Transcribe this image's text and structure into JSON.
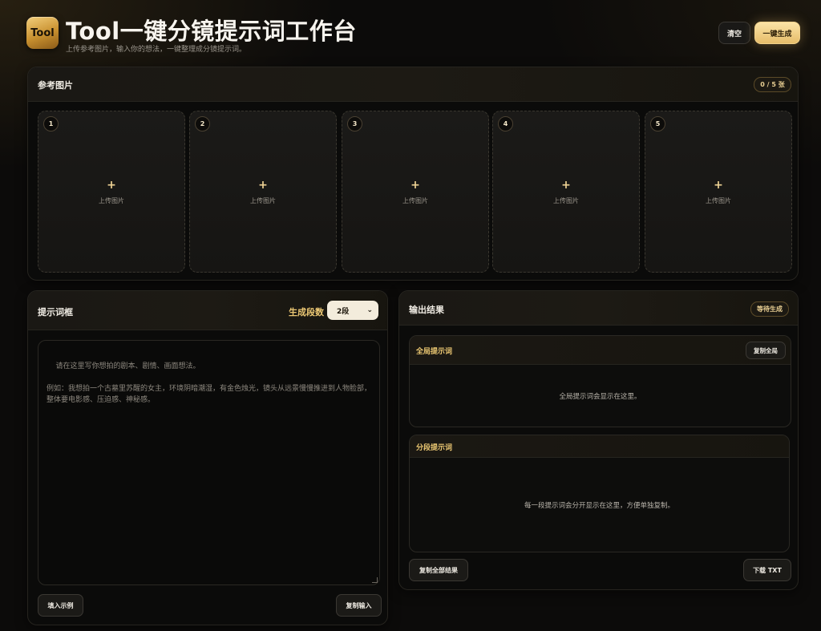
{
  "header": {
    "logo_text": "Tool",
    "title": "Tool一键分镜提示词工作台",
    "subtitle": "上传参考图片，输入你的想法，一键整理成分镜提示词。",
    "clear_label": "清空",
    "generate_label": "一键生成"
  },
  "references": {
    "title": "参考图片",
    "count_badge": "0 / 5 张",
    "slots": [
      {
        "num": "1",
        "plus": "+",
        "label": "上传图片"
      },
      {
        "num": "2",
        "plus": "+",
        "label": "上传图片"
      },
      {
        "num": "3",
        "plus": "+",
        "label": "上传图片"
      },
      {
        "num": "4",
        "plus": "+",
        "label": "上传图片"
      },
      {
        "num": "5",
        "plus": "+",
        "label": "上传图片"
      }
    ]
  },
  "prompt": {
    "title": "提示词框",
    "segments_label": "生成段数",
    "segments_value": "2段",
    "placeholder": "请在这里写你想拍的剧本、剧情、画面想法。\n\n例如：我想拍一个古墓里苏醒的女主，环境阴暗潮湿，有金色烛光，镜头从远景慢慢推进到人物脸部，整体要电影感、压迫感、神秘感。",
    "fill_example_label": "填入示例",
    "copy_input_label": "复制输入"
  },
  "output": {
    "title": "输出结果",
    "status_badge": "等待生成",
    "global": {
      "title": "全局提示词",
      "copy_label": "复制全局",
      "placeholder": "全局提示词会显示在这里。"
    },
    "segments": {
      "title": "分段提示词",
      "placeholder": "每一段提示词会分开显示在这里，方便单独复制。"
    },
    "copy_all_label": "复制全部结果",
    "download_label": "下载 TXT"
  },
  "colors": {
    "accent_gold": "#ecc874",
    "background": "#0c0b0a",
    "panel_border": "#26241f"
  }
}
